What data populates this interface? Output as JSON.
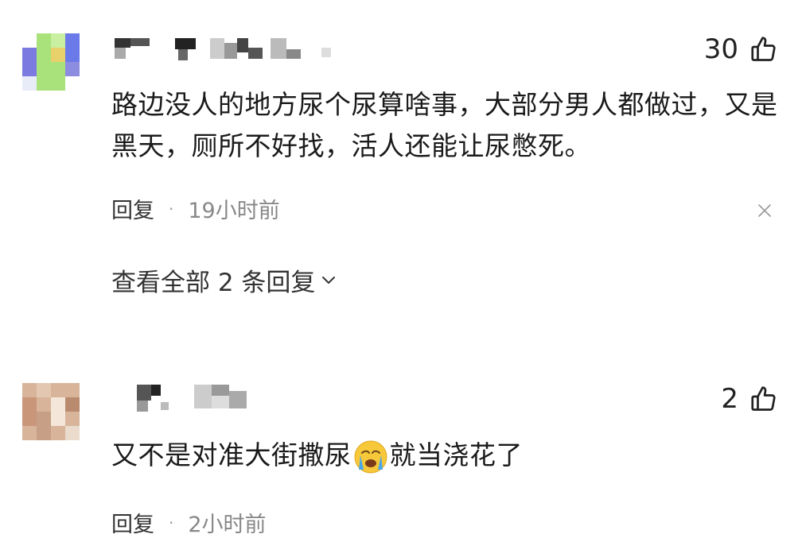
{
  "comments": [
    {
      "likes": "30",
      "text": "路边没人的地方尿个尿算啥事，大部分男人都做过，又是黑天，厕所不好找，活人还能让尿憋死。",
      "reply_label": "回复",
      "separator": "·",
      "time": "19小时前",
      "view_replies": "查看全部 2 条回复"
    },
    {
      "likes": "2",
      "text_before": "又不是对准大街撒尿",
      "emoji": "crying-face",
      "text_after": "就当浇花了",
      "reply_label": "回复",
      "separator": "·",
      "time": "2小时前"
    }
  ],
  "colors": {
    "text": "#1a1a1a",
    "meta": "#888888",
    "icon": "#222222"
  }
}
